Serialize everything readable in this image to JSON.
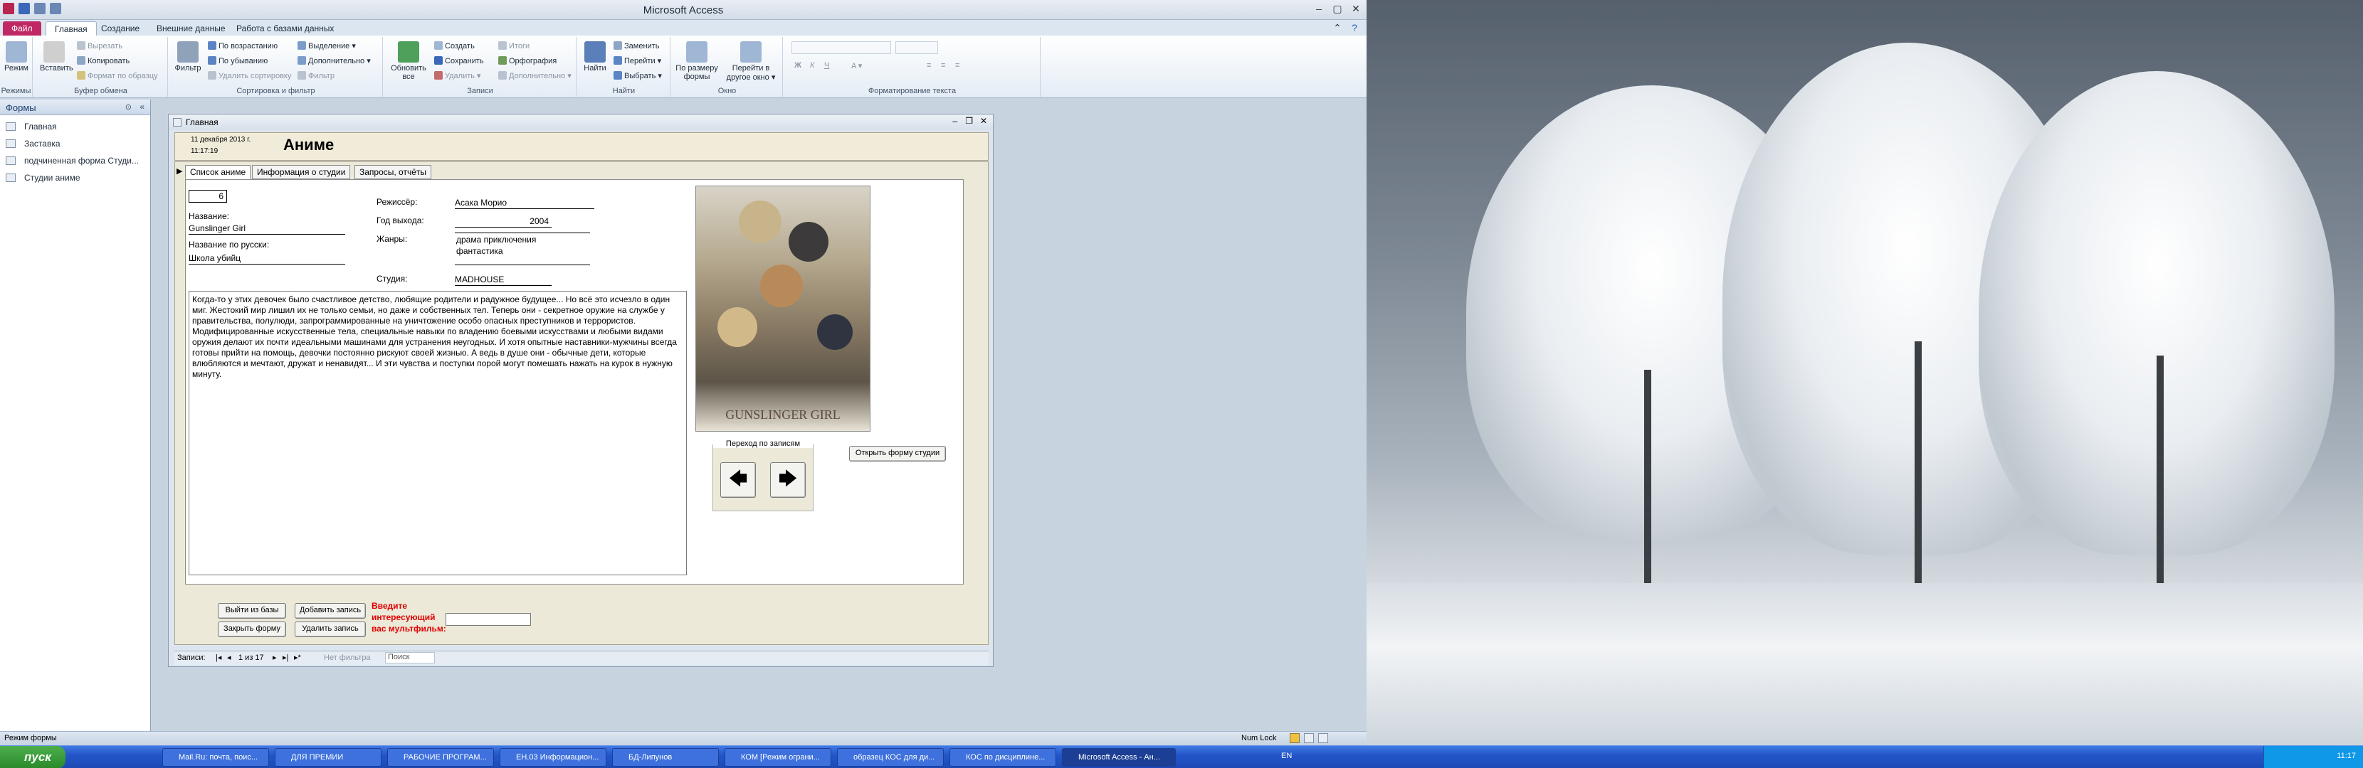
{
  "app": {
    "title": "Microsoft Access"
  },
  "ribbon_tabs": [
    "Файл",
    "Главная",
    "Создание",
    "Внешние данные",
    "Работа с базами данных"
  ],
  "ribbon": {
    "views": {
      "label": "Режимы",
      "btn": "Режим"
    },
    "clipboard": {
      "label": "Буфер обмена",
      "paste": "Вставить",
      "cut": "Вырезать",
      "copy": "Копировать",
      "format": "Формат по образцу"
    },
    "sort": {
      "label": "Сортировка и фильтр",
      "filter": "Фильтр",
      "asc": "По возрастанию",
      "desc": "По убыванию",
      "remove_sort": "Удалить сортировку",
      "selection": "Выделение",
      "advanced": "Дополнительно",
      "toggle": "Фильтр"
    },
    "records": {
      "label": "Записи",
      "refresh": "Обновить все",
      "new": "Создать",
      "save": "Сохранить",
      "delete": "Удалить",
      "totals": "Итоги",
      "spelling": "Орфография",
      "more": "Дополнительно"
    },
    "find": {
      "label": "Найти",
      "find": "Найти",
      "replace": "Заменить",
      "goto": "Перейти",
      "select": "Выбрать"
    },
    "window": {
      "label": "Окно",
      "fit": "По размеру формы",
      "switch": "Перейти в другое окно"
    },
    "text": {
      "label": "Форматирование текста"
    }
  },
  "nav": {
    "title": "Формы",
    "items": [
      "Главная",
      "Заставка",
      "подчиненная форма Студи...",
      "Студии аниме"
    ]
  },
  "form": {
    "window_title": "Главная",
    "date": "11 декабря 2013 г.",
    "time": "11:17:19",
    "heading": "Аниме",
    "tabs": [
      "Список аниме",
      "Информация о студии",
      "Запросы, отчёты"
    ],
    "id_value": "6",
    "name_label": "Название:",
    "name_value": "Gunslinger Girl",
    "ru_label": "Название по русски:",
    "ru_value": "Школа убийц",
    "director_label": "Режиссёр:",
    "director_value": "Асака Морио",
    "year_label": "Год выхода:",
    "year_value": "2004",
    "genres_label": "Жанры:",
    "genre_1": "драма приключения",
    "genre_2": "фантастика",
    "studio_label": "Студия:",
    "studio_value": "MADHOUSE",
    "description": "Когда-то у этих девочек было счастливое детство, любящие родители и радужное будущее... Но всё это исчезло в один миг. Жестокий мир лишил их не только семьи, но даже и собственных тел. Теперь они - секретное оружие на службе у правительства, полулюди, запрограммированные на уничтожение особо опасных преступников и террористов. Модифицированные искусственные тела, специальные навыки по владению боевыми искусствами и любыми видами оружия делают их почти идеальными машинами для устранения неугодных. И хотя опытные наставники-мужчины всегда готовы прийти на помощь, девочки постоянно рискуют своей жизнью. А ведь в душе они - обычные дети, которые влюбляются и мечтают, дружат и ненавидят... И эти чувства и поступки порой могут помешать нажать на курок в нужную минуту.",
    "poster_caption": "GUNSLINGER GIRL",
    "nav_group": "Переход по записям",
    "open_studio": "Открыть форму студии",
    "exit": "Выйти из базы",
    "add": "Добавить запись",
    "close": "Закрыть форму",
    "delete": "Удалить запись",
    "search_prompt": "Введите интересующий вас мультфильм:",
    "search_value": ""
  },
  "recordnav": {
    "label": "Записи:",
    "position": "1 из 17",
    "filter": "Нет фильтра",
    "search": "Поиск"
  },
  "status": {
    "left": "Режим формы",
    "numlock": "Num Lock"
  },
  "taskbar": {
    "start": "пуск",
    "tasks": [
      "Mail.Ru: почта, поис...",
      "ДЛЯ ПРЕМИИ",
      "РАБОЧИЕ ПРОГРАМ...",
      "ЕН.03 Информацион...",
      "БД-Липунов",
      "КОМ [Режим ограни...",
      "образец КОС для ди...",
      "КОС по дисциплине...",
      "Microsoft Access - Ан..."
    ],
    "lang": "EN",
    "clock": "11:17"
  }
}
